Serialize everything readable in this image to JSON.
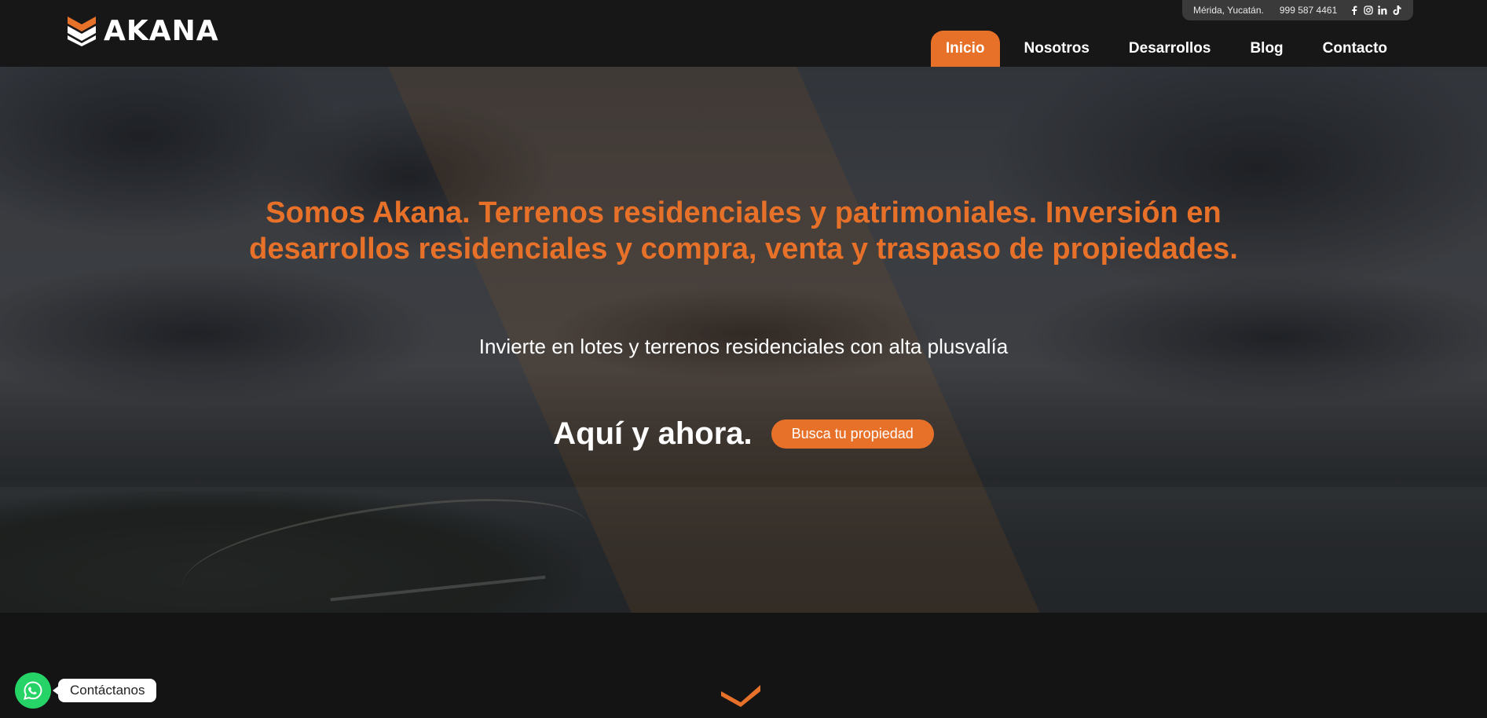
{
  "brand": {
    "name": "AKANA",
    "logo_icon": "akana-chevron-logo-icon",
    "accent": "#e8712a"
  },
  "topbar": {
    "location": "Mérida, Yucatán.",
    "phone": "999 587 4461",
    "socials": [
      "facebook-icon",
      "instagram-icon",
      "linkedin-icon",
      "tiktok-icon"
    ]
  },
  "nav": {
    "items": [
      {
        "label": "Inicio",
        "active": true
      },
      {
        "label": "Nosotros",
        "active": false
      },
      {
        "label": "Desarrollos",
        "active": false
      },
      {
        "label": "Blog",
        "active": false
      },
      {
        "label": "Contacto",
        "active": false
      }
    ]
  },
  "hero": {
    "headline": "Somos Akana. Terrenos residenciales y patrimoniales. Inversión en desarrollos residenciales y compra, venta y traspaso de propiedades.",
    "subline": "Invierte en lotes y terrenos residenciales con alta plusvalía",
    "cta_text": "Aquí y ahora.",
    "cta_button": "Busca tu propiedad"
  },
  "whatsapp": {
    "label": "Contáctanos",
    "icon": "whatsapp-icon",
    "color": "#25d366"
  },
  "section_icon": "chevron-down-icon"
}
